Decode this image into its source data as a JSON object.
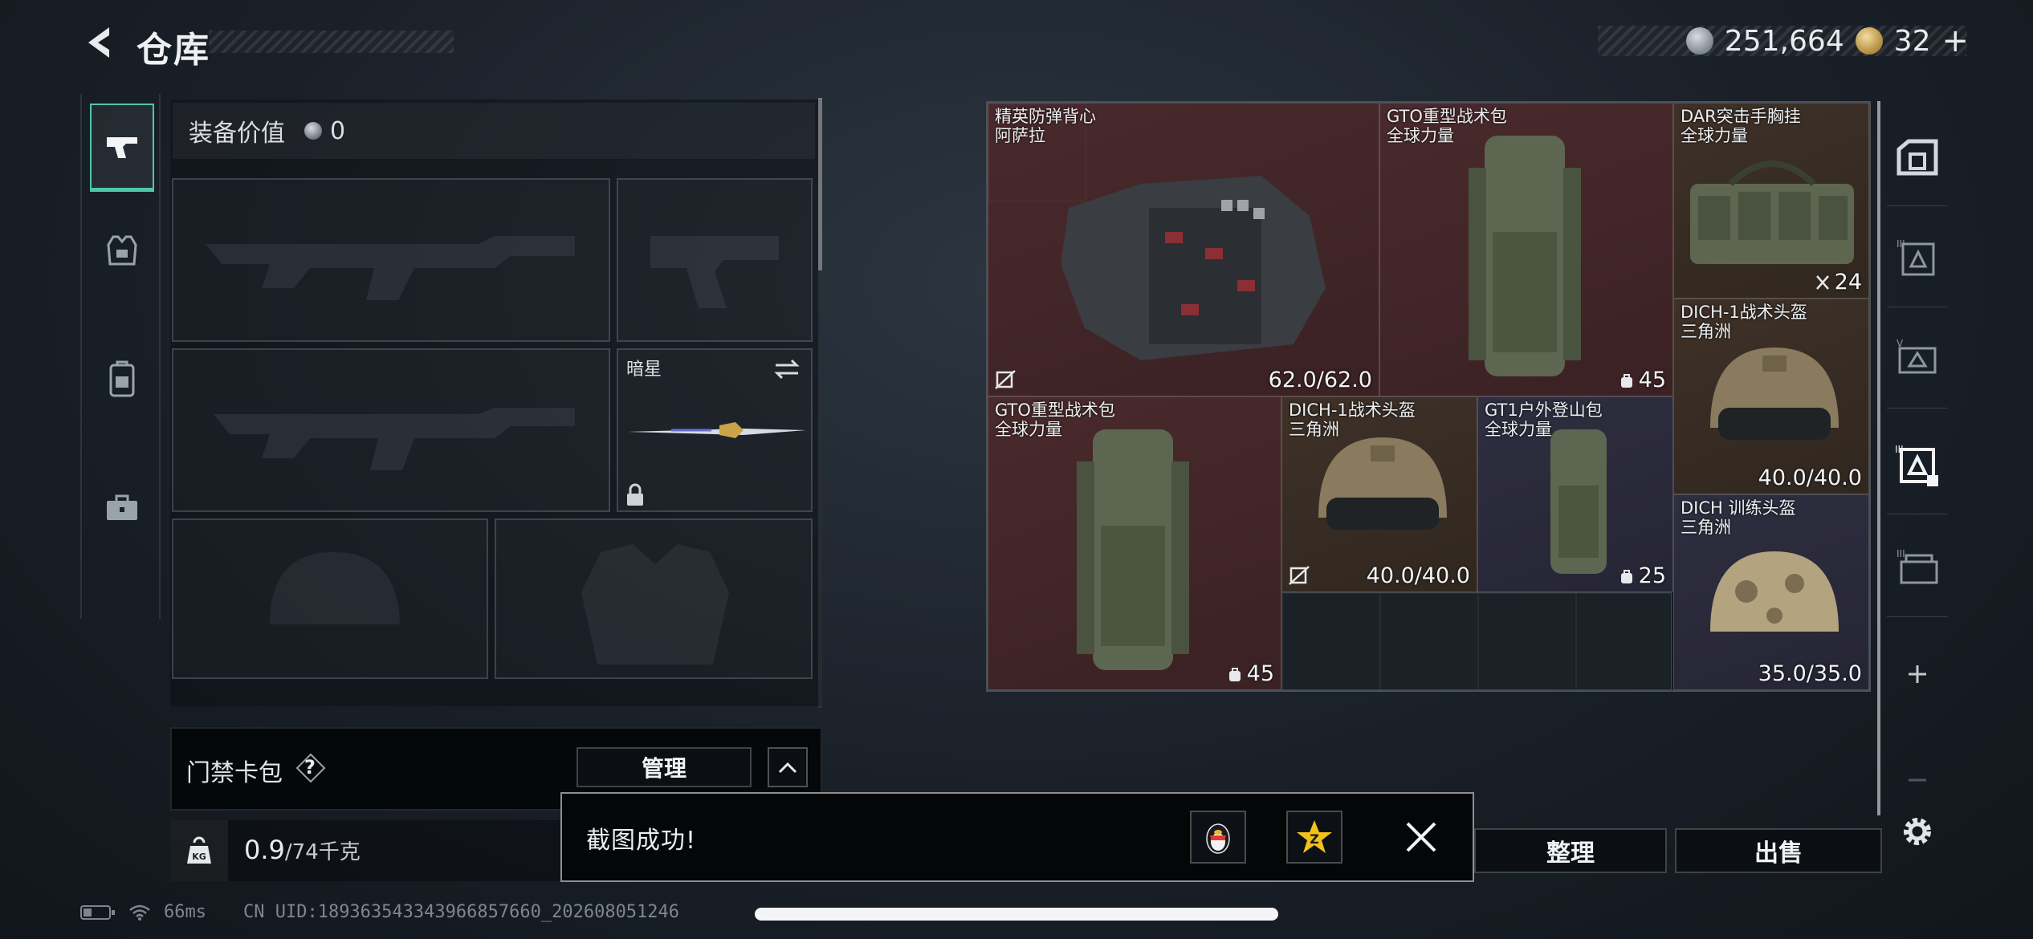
{
  "header": {
    "title": "仓库",
    "currency_primary": "251,664",
    "currency_secondary": "32",
    "currency_secondary_plus": "+"
  },
  "left_tabs": [
    {
      "name": "weapon",
      "icon": "pistol-icon",
      "active": true
    },
    {
      "name": "armor",
      "icon": "vest-icon",
      "active": false
    },
    {
      "name": "backpack",
      "icon": "backpack-icon",
      "active": false
    },
    {
      "name": "supplies",
      "icon": "toolbox-icon",
      "active": false
    }
  ],
  "equipment": {
    "value_label": "装备价值",
    "value": "0",
    "knife_slot_name": "暗星"
  },
  "access_card": {
    "title": "门禁卡包",
    "help": "?",
    "manage_label": "管理"
  },
  "weight": {
    "current": "0.9",
    "max": "/74千克"
  },
  "grid_items": [
    {
      "name": "精英防弹背心",
      "brand": "阿萨拉",
      "durability": "62.0/62.0",
      "rarity": "red"
    },
    {
      "name": "GTO重型战术包",
      "brand": "全球力量",
      "capacity": "45",
      "rarity": "red"
    },
    {
      "name": "DAR突击手胸挂",
      "brand": "全球力量",
      "capacity": "24",
      "rarity": "brown"
    },
    {
      "name": "DICH-1战术头盔",
      "brand": "三角洲",
      "durability": "40.0/40.0",
      "rarity": "brown"
    },
    {
      "name": "GTO重型战术包",
      "brand": "全球力量",
      "capacity": "45",
      "rarity": "red"
    },
    {
      "name": "DICH-1战术头盔",
      "brand": "三角洲",
      "durability": "40.0/40.0",
      "rarity": "brown"
    },
    {
      "name": "GT1户外登山包",
      "brand": "全球力量",
      "capacity": "25",
      "rarity": "purple"
    },
    {
      "name": "DICH 训练头盔",
      "brand": "三角洲",
      "durability": "35.0/35.0",
      "rarity": "purple"
    }
  ],
  "actions": {
    "sort_label": "整理",
    "sell_label": "出售"
  },
  "toast": {
    "message": "截图成功!"
  },
  "status_bar": {
    "ping": "66ms",
    "uid": "CN UID:18936354334396685766​0_202608051246"
  },
  "colors": {
    "accent": "#4ec7a8",
    "rarity_red": "#4a2a2c",
    "rarity_brown": "#3e3128",
    "rarity_purple": "#2f2e40"
  }
}
